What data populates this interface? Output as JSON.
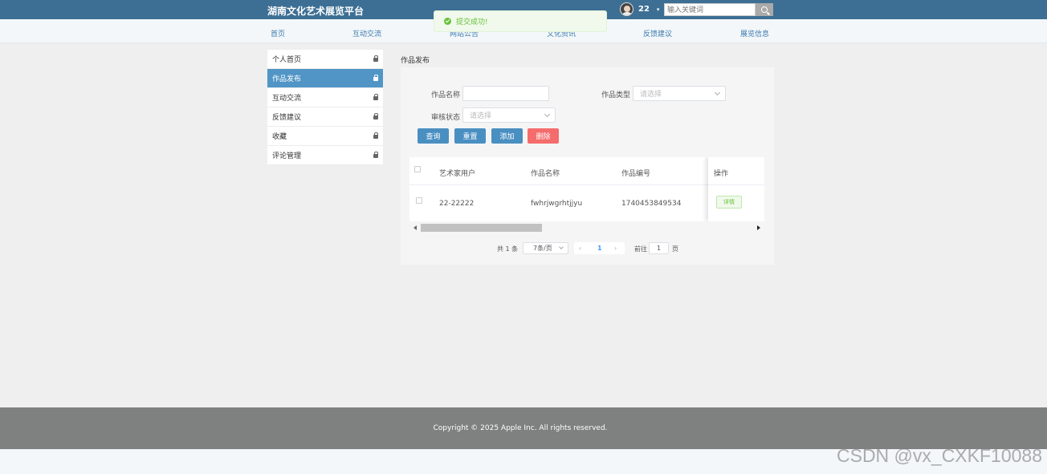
{
  "header": {
    "site_title": "湖南文化艺术展览平台",
    "username": "22",
    "caret": "▾",
    "search_placeholder": "输入关键词"
  },
  "toast": {
    "message": "提交成功!"
  },
  "nav": {
    "items": [
      "首页",
      "互动交流",
      "网站公告",
      "文化资讯",
      "反馈建议",
      "展览信息"
    ]
  },
  "sidebar": {
    "items": [
      "个人首页",
      "作品发布",
      "互动交流",
      "反馈建议",
      "收藏",
      "评论管理"
    ],
    "active": "作品发布"
  },
  "page": {
    "heading": "作品发布"
  },
  "filters": {
    "name_label": "作品名称",
    "name_value": "",
    "type_label": "作品类型",
    "type_placeholder": "请选择",
    "status_label": "审核状态",
    "status_placeholder": "请选择"
  },
  "buttons": {
    "query": "查询",
    "reset": "重置",
    "add": "添加",
    "delete": "删除"
  },
  "table": {
    "columns": [
      "艺术家用户",
      "作品名称",
      "作品编号",
      "操作"
    ],
    "rows": [
      {
        "artist": "22-22222",
        "work_name": "fwhrjwgrhtjjyu",
        "work_no": "1740453849534",
        "action": "详情"
      }
    ]
  },
  "pagination": {
    "total": "共 1 条",
    "page_size": "7条/页",
    "current_page": "1",
    "goto_label": "前往",
    "goto_value": "1",
    "page_unit": "页"
  },
  "footer": {
    "copyright": "Copyright © 2025 Apple Inc. All rights reserved."
  },
  "watermark": "CSDN @vx_CXKF10088"
}
